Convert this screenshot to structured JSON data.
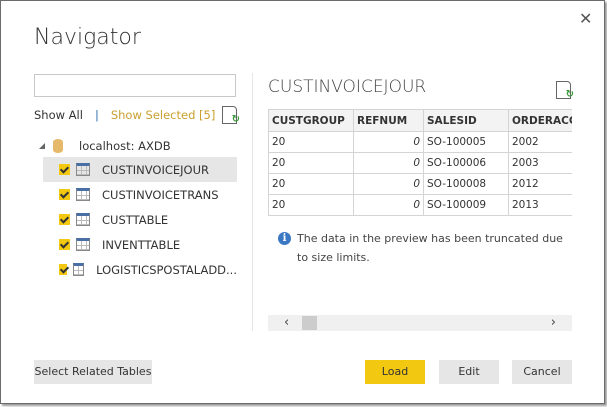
{
  "dialog": {
    "title": "Navigator",
    "close_icon": "close-icon"
  },
  "left": {
    "search": {
      "value": "",
      "placeholder": ""
    },
    "show_all": "Show All",
    "separator": "|",
    "show_selected": "Show Selected [5]",
    "server": "localhost: AXDB",
    "tables": [
      {
        "label": "CUSTINVOICEJOUR",
        "checked": true,
        "selected": true
      },
      {
        "label": "CUSTINVOICETRANS",
        "checked": true,
        "selected": false
      },
      {
        "label": "CUSTTABLE",
        "checked": true,
        "selected": false
      },
      {
        "label": "INVENTTABLE",
        "checked": true,
        "selected": false
      },
      {
        "label": "LOGISTICSPOSTALADD...",
        "checked": true,
        "selected": false
      }
    ]
  },
  "preview": {
    "title": "CUSTINVOICEJOUR",
    "columns": [
      "CUSTGROUP",
      "REFNUM",
      "SALESID",
      "ORDERACCO"
    ],
    "rows": [
      [
        "20",
        "0",
        "SO-100005",
        "2002"
      ],
      [
        "20",
        "0",
        "SO-100006",
        "2003"
      ],
      [
        "20",
        "0",
        "SO-100008",
        "2012"
      ],
      [
        "20",
        "0",
        "SO-100009",
        "2013"
      ]
    ],
    "info_text": "The data in the preview has been truncated due to size limits.",
    "info_icon_glyph": "i",
    "scroll_left": "‹",
    "scroll_right": "›"
  },
  "footer": {
    "select_related": "Select Related Tables",
    "load": "Load",
    "edit": "Edit",
    "cancel": "Cancel"
  },
  "colors": {
    "accent": "#f2c811",
    "link_selected": "#c8a030",
    "info": "#3b78c3"
  }
}
